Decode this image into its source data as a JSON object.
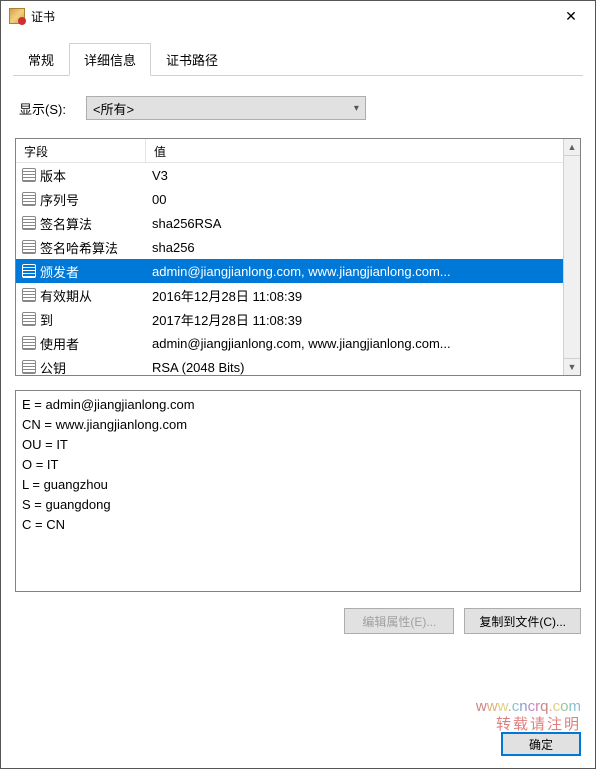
{
  "window": {
    "title": "证书"
  },
  "tabs": {
    "general": "常规",
    "details": "详细信息",
    "path": "证书路径"
  },
  "show": {
    "label": "显示(S):",
    "value": "<所有>"
  },
  "fields": {
    "head_field": "字段",
    "head_value": "值",
    "rows": [
      {
        "f": "版本",
        "v": "V3"
      },
      {
        "f": "序列号",
        "v": "00"
      },
      {
        "f": "签名算法",
        "v": "sha256RSA"
      },
      {
        "f": "签名哈希算法",
        "v": "sha256"
      },
      {
        "f": "颁发者",
        "v": "admin@jiangjianlong.com, www.jiangjianlong.com..."
      },
      {
        "f": "有效期从",
        "v": "2016年12月28日 11:08:39"
      },
      {
        "f": "到",
        "v": "2017年12月28日 11:08:39"
      },
      {
        "f": "使用者",
        "v": "admin@jiangjianlong.com, www.jiangjianlong.com..."
      },
      {
        "f": "公钥",
        "v": "RSA (2048 Bits)"
      }
    ],
    "selected_index": 4
  },
  "detail": "E = admin@jiangjianlong.com\nCN = www.jiangjianlong.com\nOU = IT\nO = IT\nL = guangzhou\nS = guangdong\nC = CN",
  "buttons": {
    "edit": "编辑属性(E)...",
    "copy": "复制到文件(C)...",
    "ok": "确定"
  },
  "watermark": {
    "url": "www.cncrq.com",
    "note": "转载请注明"
  }
}
